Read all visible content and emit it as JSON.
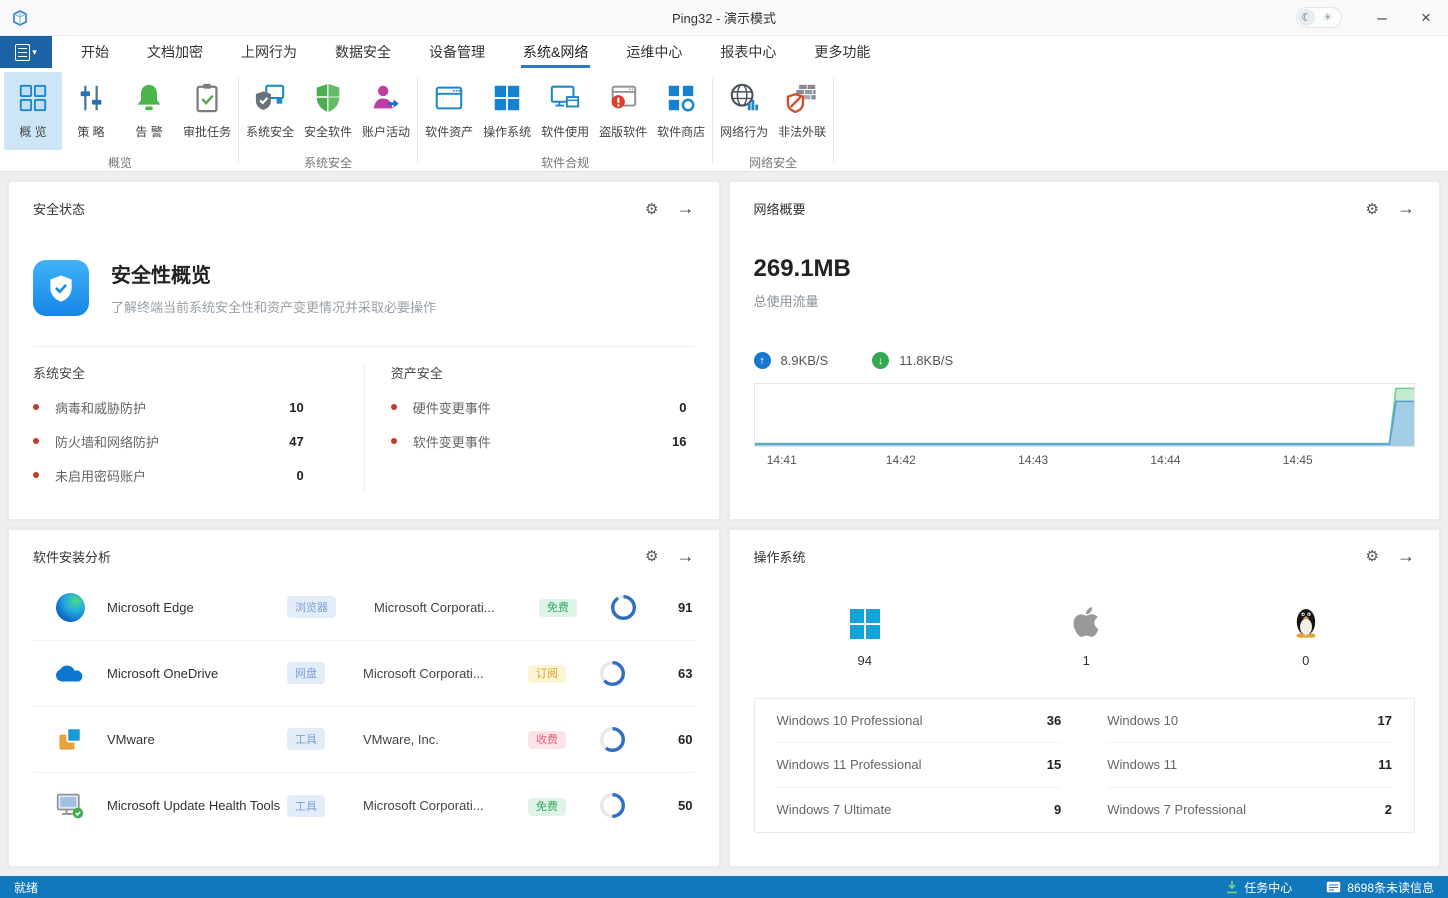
{
  "window": {
    "title": "Ping32 - 演示模式",
    "minimize": "–",
    "close": "×"
  },
  "tabs": [
    "开始",
    "文档加密",
    "上网行为",
    "数据安全",
    "设备管理",
    "系统&网络",
    "运维中心",
    "报表中心",
    "更多功能"
  ],
  "active_tab": "系统&网络",
  "ribbon": {
    "groups": [
      {
        "label": "概览",
        "buttons": [
          {
            "label": "概 览",
            "selected": true
          },
          {
            "label": "策 略"
          },
          {
            "label": "告 警"
          },
          {
            "label": "审批任务"
          }
        ]
      },
      {
        "label": "系统安全",
        "buttons": [
          {
            "label": "系统安全"
          },
          {
            "label": "安全软件"
          },
          {
            "label": "账户活动"
          }
        ]
      },
      {
        "label": "软件合规",
        "buttons": [
          {
            "label": "软件资产"
          },
          {
            "label": "操作系统"
          },
          {
            "label": "软件使用"
          },
          {
            "label": "盗版软件"
          },
          {
            "label": "软件商店"
          }
        ]
      },
      {
        "label": "网络安全",
        "buttons": [
          {
            "label": "网络行为"
          },
          {
            "label": "非法外联"
          }
        ]
      }
    ]
  },
  "security": {
    "panel_title": "安全状态",
    "heading": "安全性概览",
    "description": "了解终端当前系统安全性和资产变更情况并采取必要操作",
    "sections": [
      {
        "title": "系统安全",
        "items": [
          {
            "label": "病毒和威胁防护",
            "value": "10"
          },
          {
            "label": "防火墙和网络防护",
            "value": "47"
          },
          {
            "label": "未启用密码账户",
            "value": "0"
          }
        ]
      },
      {
        "title": "资产安全",
        "items": [
          {
            "label": "硬件变更事件",
            "value": "0"
          },
          {
            "label": "软件变更事件",
            "value": "16"
          }
        ]
      }
    ]
  },
  "network": {
    "panel_title": "网络概要",
    "total": "269.1MB",
    "total_label": "总使用流量",
    "upload_rate": "8.9KB/S",
    "download_rate": "11.8KB/S",
    "upload_arrow": "↑",
    "download_arrow": "↓"
  },
  "chart_data": {
    "type": "area",
    "title": "网络概要流量趋势",
    "x_ticks": [
      "14:41",
      "14:42",
      "14:43",
      "14:44",
      "14:45"
    ],
    "tick_fracs": [
      0.02,
      0.2,
      0.4,
      0.6,
      0.8
    ],
    "legend_position": "none",
    "grid": false,
    "series": [
      {
        "name": "下载",
        "rate_label": "11.8KB/S",
        "color": "#6ecf8e",
        "fill": "rgba(126,213,152,0.45)",
        "points_norm": [
          [
            0,
            0.04
          ],
          [
            0.962,
            0.04
          ],
          [
            0.972,
            0.93
          ],
          [
            1,
            0.93
          ]
        ]
      },
      {
        "name": "上传",
        "rate_label": "8.9KB/S",
        "color": "#5b9bd5",
        "fill": "rgba(150,195,235,0.75)",
        "points_norm": [
          [
            0,
            0.03
          ],
          [
            0.962,
            0.03
          ],
          [
            0.972,
            0.72
          ],
          [
            1,
            0.72
          ]
        ]
      }
    ]
  },
  "software": {
    "panel_title": "软件安装分析",
    "rows": [
      {
        "name": "Microsoft Edge",
        "category": "浏览器",
        "vendor": "Microsoft Corporati...",
        "price": "免费",
        "price_type": "free",
        "value": 91
      },
      {
        "name": "Microsoft OneDrive",
        "category": "网盘",
        "vendor": "Microsoft Corporati...",
        "price": "订阅",
        "price_type": "subscription",
        "value": 63
      },
      {
        "name": "VMware",
        "category": "工具",
        "vendor": "VMware, Inc.",
        "price": "收费",
        "price_type": "paid",
        "value": 60
      },
      {
        "name": "Microsoft Update Health Tools",
        "category": "工具",
        "vendor": "Microsoft Corporati...",
        "price": "免费",
        "price_type": "free",
        "value": 50
      }
    ]
  },
  "os": {
    "panel_title": "操作系统",
    "platforms": [
      {
        "name": "windows",
        "count": "94"
      },
      {
        "name": "apple",
        "count": "1"
      },
      {
        "name": "linux",
        "count": "0"
      }
    ],
    "versions": [
      [
        {
          "label": "Windows 10 Professional",
          "value": "36"
        },
        {
          "label": "Windows 10",
          "value": "17"
        }
      ],
      [
        {
          "label": "Windows 11 Professional",
          "value": "15"
        },
        {
          "label": "Windows 11",
          "value": "11"
        }
      ],
      [
        {
          "label": "Windows 7 Ultimate",
          "value": "9"
        },
        {
          "label": "Windows 7 Professional",
          "value": "2"
        }
      ]
    ]
  },
  "statusbar": {
    "ready": "就绪",
    "task_center": "任务中心",
    "unread_messages": "8698条未读信息"
  },
  "colors": {
    "accent_blue": "#1278be",
    "menu_blue": "#1b63a6",
    "tab_underline": "#2b7ac6",
    "donut_blue": "#2f6fc1",
    "alert_red": "#c5392a",
    "upload_blue": "#1677d2",
    "download_green": "#36a854"
  }
}
